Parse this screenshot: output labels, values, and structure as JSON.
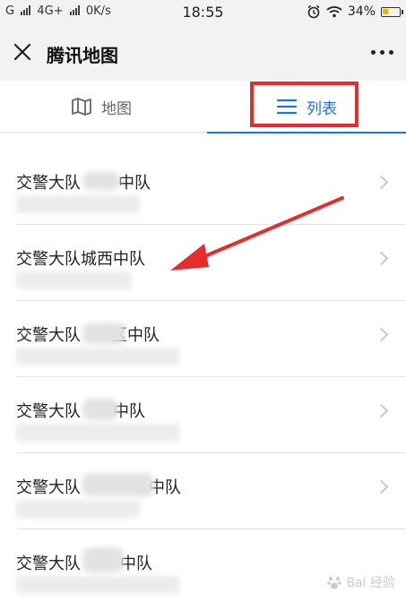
{
  "status_bar": {
    "carrier_left": "G",
    "network": "4G+",
    "speed": "0K/s",
    "time": "18:55",
    "battery": "34%",
    "battery_level": 0.34
  },
  "title_bar": {
    "title": "腾讯地图"
  },
  "tabs": [
    {
      "label": "地图",
      "icon": "map-icon",
      "selected": false
    },
    {
      "label": "列表",
      "icon": "list-icon",
      "selected": true
    }
  ],
  "list": {
    "items": [
      {
        "name": "交警大队",
        "name_suffix": "中队"
      },
      {
        "name": "交警大队城西中队",
        "name_suffix": ""
      },
      {
        "name": "交警大队",
        "name_suffix": "区中队"
      },
      {
        "name": "交警大队",
        "name_suffix": "中队"
      },
      {
        "name": "交警大队",
        "name_suffix": "中队"
      },
      {
        "name": "交警大队",
        "name_suffix": "中队"
      }
    ]
  },
  "colors": {
    "accent": "#1a73e8",
    "highlight": "#e82b2b"
  },
  "watermark": {
    "text": "Bai 经验"
  }
}
